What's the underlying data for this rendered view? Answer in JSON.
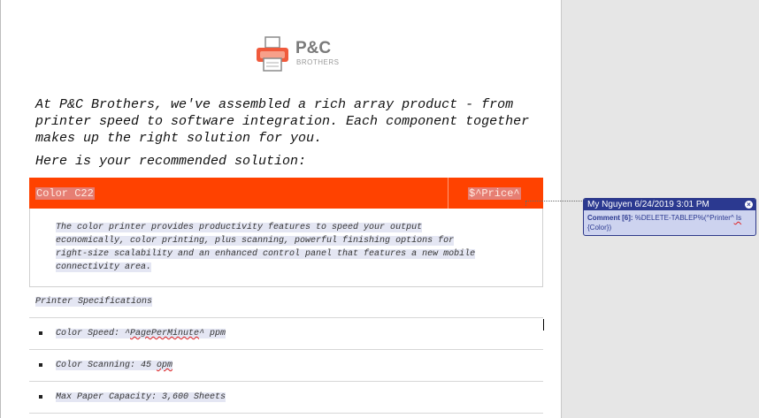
{
  "logo": {
    "name": "P&C",
    "sub": "BROTHERS"
  },
  "intro": {
    "line1": "At P&C Brothers, we've assembled a rich array product - from",
    "line2": "printer speed to software integration. Each component together",
    "line3": "makes up the right solution for you."
  },
  "recommend_label": "Here is your recommended solution:",
  "product": {
    "name": "Color C22",
    "price": "$^Price^",
    "header_color": "#ff4200",
    "description_lines": [
      "The color printer provides productivity features to speed your output",
      "economically, color printing, plus scanning, powerful finishing options for",
      "right-size scalability and an enhanced control panel that features a new mobile",
      "connectivity area."
    ]
  },
  "specs": {
    "title": "Printer Specifications",
    "items": [
      {
        "prefix": "Color Speed: ^",
        "field": "PagePerMinute",
        "suffix": "^ ppm"
      },
      {
        "prefix": "Color Scanning: 45 ",
        "field": "opm",
        "suffix": ""
      },
      {
        "prefix": "Max Paper Capacity: 3,600 Sheets",
        "field": "",
        "suffix": ""
      }
    ]
  },
  "comment": {
    "author_date": "My Nguyen 6/24/2019 3:01 PM",
    "label": "Comment [6]:",
    "text_a": " %DELETE-TABLEP%(^Printer^",
    "text_b": " Is",
    "text_c": "{Color})",
    "accent": "#2b3990",
    "background": "#cdd3ef"
  }
}
